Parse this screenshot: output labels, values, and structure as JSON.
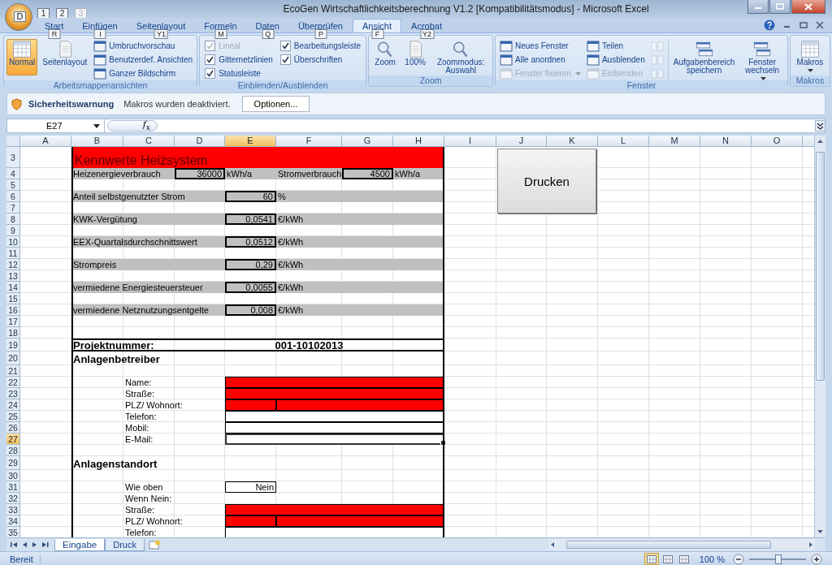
{
  "window": {
    "title": "EcoGen Wirtschaftlichkeitsberechnung V1.2  [Kompatibilitätsmodus] - Microsoft Excel"
  },
  "quick_access": {
    "office_keytip": "D",
    "items": [
      {
        "keytip": "1",
        "disabled": false
      },
      {
        "keytip": "2",
        "disabled": false
      },
      {
        "keytip": "3",
        "disabled": true
      }
    ]
  },
  "tabs": [
    {
      "label": "Start",
      "keytip": "R",
      "selected": false
    },
    {
      "label": "Einfügen",
      "keytip": "I",
      "selected": false
    },
    {
      "label": "Seitenlayout",
      "keytip": "Y1",
      "selected": false
    },
    {
      "label": "Formeln",
      "keytip": "M",
      "selected": false
    },
    {
      "label": "Daten",
      "keytip": "Q",
      "selected": false
    },
    {
      "label": "Überprüfen",
      "keytip": "P",
      "selected": false
    },
    {
      "label": "Ansicht",
      "keytip": "F",
      "selected": true
    },
    {
      "label": "Acrobat",
      "keytip": "Y2",
      "selected": false
    }
  ],
  "ribbon": [
    {
      "label": "Arbeitsmappenansichten",
      "columns": [
        [
          {
            "kind": "large",
            "label": "Normal",
            "selected": true,
            "disabled": false,
            "dropdown": false
          }
        ],
        [
          {
            "kind": "large",
            "label": "Seitenlayout",
            "selected": false,
            "disabled": false,
            "dropdown": false
          }
        ],
        [
          {
            "kind": "small",
            "label": "Umbruchvorschau",
            "disabled": false,
            "dropdown": false
          },
          {
            "kind": "small",
            "label": "Benutzerdef. Ansichten",
            "disabled": false,
            "dropdown": false
          },
          {
            "kind": "small",
            "label": "Ganzer Bildschirm",
            "disabled": false,
            "dropdown": false
          }
        ]
      ]
    },
    {
      "label": "Einblenden/Ausblenden",
      "columns": [
        [
          {
            "kind": "check",
            "label": "Lineal",
            "checked": true,
            "disabled": true
          },
          {
            "kind": "check",
            "label": "Gitternetzlinien",
            "checked": true,
            "disabled": false
          },
          {
            "kind": "check",
            "label": "Statusleiste",
            "checked": true,
            "disabled": false
          }
        ],
        [
          {
            "kind": "check",
            "label": "Bearbeitungsleiste",
            "checked": true,
            "disabled": false
          },
          {
            "kind": "check",
            "label": "Überschriften",
            "checked": true,
            "disabled": false
          }
        ]
      ]
    },
    {
      "label": "Zoom",
      "columns": [
        [
          {
            "kind": "large",
            "label": "Zoom",
            "selected": false,
            "disabled": false,
            "dropdown": false
          }
        ],
        [
          {
            "kind": "large",
            "label": "100%",
            "selected": false,
            "disabled": false,
            "dropdown": false
          }
        ],
        [
          {
            "kind": "large",
            "label": "Zoommodus: Auswahl",
            "selected": false,
            "disabled": false,
            "dropdown": false
          }
        ]
      ]
    },
    {
      "label": "Fenster",
      "columns": [
        [
          {
            "kind": "small",
            "label": "Neues Fenster",
            "disabled": false,
            "dropdown": false
          },
          {
            "kind": "small",
            "label": "Alle anordnen",
            "disabled": false,
            "dropdown": false
          },
          {
            "kind": "small",
            "label": "Fenster fixieren",
            "disabled": true,
            "dropdown": true
          }
        ],
        [
          {
            "kind": "small",
            "label": "Teilen",
            "disabled": false,
            "dropdown": false
          },
          {
            "kind": "small",
            "label": "Ausblenden",
            "disabled": false,
            "dropdown": false
          },
          {
            "kind": "small",
            "label": "Einblenden",
            "disabled": true,
            "dropdown": false
          }
        ],
        [
          {
            "kind": "icon",
            "disabled": true
          },
          {
            "kind": "icon",
            "disabled": true
          },
          {
            "kind": "icon",
            "disabled": true
          }
        ],
        [
          {
            "kind": "large",
            "label": "Aufgabenbereich speichern",
            "selected": false,
            "disabled": false,
            "dropdown": false
          }
        ],
        [
          {
            "kind": "large",
            "label": "Fenster wechseln",
            "selected": false,
            "disabled": false,
            "dropdown": true
          }
        ]
      ]
    },
    {
      "label": "Makros",
      "columns": [
        [
          {
            "kind": "large",
            "label": "Makros",
            "selected": false,
            "disabled": false,
            "dropdown": true
          }
        ]
      ]
    }
  ],
  "security_bar": {
    "title": "Sicherheitswarnung",
    "message": "Makros wurden deaktiviert.",
    "button": "Optionen..."
  },
  "formula_bar": {
    "name_box": "E27",
    "fx": "f$_{x}$"
  },
  "sheet": {
    "columns": [
      {
        "label": "A",
        "selected": false
      },
      {
        "label": "B",
        "selected": false
      },
      {
        "label": "C",
        "selected": false
      },
      {
        "label": "D",
        "selected": false
      },
      {
        "label": "E",
        "selected": true
      },
      {
        "label": "F",
        "selected": false
      },
      {
        "label": "G",
        "selected": false
      },
      {
        "label": "H",
        "selected": false
      },
      {
        "label": "I",
        "selected": false
      },
      {
        "label": "J",
        "selected": false
      },
      {
        "label": "K",
        "selected": false
      },
      {
        "label": "L",
        "selected": false
      },
      {
        "label": "M",
        "selected": false
      },
      {
        "label": "N",
        "selected": false
      },
      {
        "label": "O",
        "selected": false
      }
    ],
    "rows": [
      {
        "number": "3",
        "selected": false,
        "cells": [
          "",
          {
            "kind": "title",
            "text": "Kennwerte Heizsystem"
          },
          "",
          "",
          "",
          "",
          "",
          ""
        ]
      },
      {
        "number": "4",
        "selected": false,
        "shaded": true,
        "cells": [
          "",
          {
            "kind": "label",
            "text": "Heizenergieverbrauch"
          },
          "",
          {
            "kind": "input",
            "text": "36000"
          },
          {
            "kind": "unit",
            "text": "kWh/a"
          },
          {
            "kind": "label",
            "text": "Stromverbrauch"
          },
          {
            "kind": "input",
            "text": "4500"
          },
          {
            "kind": "unit",
            "text": "kWh/a"
          }
        ]
      },
      {
        "number": "5",
        "selected": false,
        "shaded": false,
        "cells": []
      },
      {
        "number": "6",
        "selected": false,
        "shaded": true,
        "cells": [
          "",
          {
            "kind": "label",
            "text": "Anteil selbstgenutzter Strom"
          },
          "",
          "",
          {
            "kind": "input",
            "text": "60"
          },
          {
            "kind": "unit",
            "text": "%"
          }
        ]
      },
      {
        "number": "7",
        "selected": false,
        "shaded": false,
        "cells": []
      },
      {
        "number": "8",
        "selected": false,
        "shaded": true,
        "cells": [
          "",
          {
            "kind": "label",
            "text": "KWK-Vergütung"
          },
          "",
          "",
          {
            "kind": "input",
            "text": "0,0541"
          },
          {
            "kind": "unit",
            "text": "€/kWh"
          }
        ]
      },
      {
        "number": "9",
        "selected": false,
        "shaded": false,
        "cells": []
      },
      {
        "number": "10",
        "selected": false,
        "shaded": true,
        "cells": [
          "",
          {
            "kind": "label",
            "text": "EEX-Quartalsdurchschnittswert"
          },
          "",
          "",
          {
            "kind": "input",
            "text": "0,0512"
          },
          {
            "kind": "unit",
            "text": "€/kWh"
          }
        ]
      },
      {
        "number": "11",
        "selected": false,
        "shaded": false,
        "cells": []
      },
      {
        "number": "12",
        "selected": false,
        "shaded": true,
        "cells": [
          "",
          {
            "kind": "label",
            "text": "Strompreis"
          },
          "",
          "",
          {
            "kind": "input",
            "text": "0,29"
          },
          {
            "kind": "unit",
            "text": "€/kWh"
          }
        ]
      },
      {
        "number": "13",
        "selected": false,
        "shaded": false,
        "cells": []
      },
      {
        "number": "14",
        "selected": false,
        "shaded": true,
        "cells": [
          "",
          {
            "kind": "label",
            "text": "vermiedene Energiesteuersteuer"
          },
          "",
          "",
          {
            "kind": "input",
            "text": "0,0055"
          },
          {
            "kind": "unit",
            "text": "€/kWh"
          }
        ]
      },
      {
        "number": "15",
        "selected": false,
        "shaded": false,
        "cells": []
      },
      {
        "number": "16",
        "selected": false,
        "shaded": true,
        "cells": [
          "",
          {
            "kind": "label",
            "text": "vermiedene Netznutzungsentgelte"
          },
          "",
          "",
          {
            "kind": "input",
            "text": "0,008"
          },
          {
            "kind": "unit",
            "text": "€/kWh"
          }
        ]
      },
      {
        "number": "17",
        "selected": false,
        "shaded": false,
        "cells": []
      },
      {
        "number": "18",
        "selected": false,
        "shaded": false,
        "cells": []
      },
      {
        "number": "19",
        "selected": false,
        "shaded": false,
        "cells": [
          "",
          {
            "kind": "project-label",
            "text": "Projektnummer:"
          },
          "",
          "",
          "",
          {
            "kind": "project-value",
            "text": "001-10102013"
          }
        ]
      },
      {
        "number": "20",
        "selected": false,
        "shaded": false,
        "cells": [
          "",
          {
            "kind": "heading",
            "text": "Anlagenbetreiber"
          },
          "",
          ""
        ]
      },
      {
        "number": "21",
        "selected": false,
        "shaded": false,
        "cells": []
      },
      {
        "number": "22",
        "selected": false,
        "shaded": false,
        "cells": [
          "",
          "",
          {
            "kind": "label",
            "text": "Name:"
          },
          "",
          {
            "kind": "field",
            "color": "#ff0000",
            "selected": false
          },
          "",
          "",
          ""
        ]
      },
      {
        "number": "23",
        "selected": false,
        "shaded": false,
        "cells": [
          "",
          "",
          {
            "kind": "label",
            "text": "Straße:"
          },
          "",
          {
            "kind": "field",
            "color": "#ff0000",
            "selected": false
          },
          "",
          "",
          ""
        ]
      },
      {
        "number": "24",
        "selected": false,
        "shaded": false,
        "cells": [
          "",
          "",
          {
            "kind": "label",
            "text": "PLZ/ Wohnort:"
          },
          "",
          {
            "kind": "field",
            "color": "#ff0000",
            "selected": false
          },
          {
            "kind": "field",
            "color": "#ff0000",
            "selected": false
          },
          "",
          ""
        ]
      },
      {
        "number": "25",
        "selected": false,
        "shaded": false,
        "cells": [
          "",
          "",
          {
            "kind": "label",
            "text": "Telefon:"
          },
          "",
          {
            "kind": "field",
            "color": "#ffffff",
            "selected": false
          },
          "",
          "",
          ""
        ]
      },
      {
        "number": "26",
        "selected": false,
        "shaded": false,
        "cells": [
          "",
          "",
          {
            "kind": "label",
            "text": "Mobil:"
          },
          "",
          {
            "kind": "field",
            "color": "#ffffff",
            "selected": false
          },
          "",
          "",
          ""
        ]
      },
      {
        "number": "27",
        "selected": true,
        "shaded": false,
        "cells": [
          "",
          "",
          {
            "kind": "label",
            "text": "E-Mail:"
          },
          "",
          {
            "kind": "field",
            "color": "#ffffff",
            "selected": true
          },
          "",
          "",
          ""
        ]
      },
      {
        "number": "28",
        "selected": false,
        "shaded": false,
        "cells": []
      },
      {
        "number": "29",
        "selected": false,
        "shaded": false,
        "cells": [
          "",
          {
            "kind": "heading",
            "text": "Anlagenstandort"
          },
          "",
          ""
        ]
      },
      {
        "number": "30",
        "selected": false,
        "shaded": false,
        "cells": []
      },
      {
        "number": "31",
        "selected": false,
        "shaded": false,
        "cells": [
          "",
          "",
          {
            "kind": "label",
            "text": "Wie oben"
          },
          "",
          {
            "kind": "field",
            "color": "#ffffff",
            "selected": false,
            "text": "Nein"
          }
        ]
      },
      {
        "number": "32",
        "selected": false,
        "shaded": false,
        "cells": [
          "",
          "",
          {
            "kind": "label",
            "text": "Wenn Nein:"
          },
          ""
        ]
      },
      {
        "number": "33",
        "selected": false,
        "shaded": false,
        "cells": [
          "",
          "",
          {
            "kind": "label",
            "text": "Straße:"
          },
          "",
          {
            "kind": "field",
            "color": "#ff0000",
            "selected": false
          },
          "",
          "",
          ""
        ]
      },
      {
        "number": "34",
        "selected": false,
        "shaded": false,
        "cells": [
          "",
          "",
          {
            "kind": "label",
            "text": "PLZ/ Wohnort:"
          },
          "",
          {
            "kind": "field",
            "color": "#ff0000",
            "selected": false
          },
          {
            "kind": "field",
            "color": "#ff0000",
            "selected": false
          },
          "",
          ""
        ]
      },
      {
        "number": "35",
        "selected": false,
        "shaded": false,
        "cells": [
          "",
          "",
          {
            "kind": "label",
            "text": "Telefon:"
          },
          "",
          {
            "kind": "field",
            "color": "#ffffff",
            "selected": false
          },
          "",
          "",
          ""
        ]
      }
    ],
    "button": {
      "label": "Drucken"
    }
  },
  "sheet_tabs": [
    {
      "label": "Eingabe",
      "selected": true
    },
    {
      "label": "Druck",
      "selected": false
    }
  ],
  "status_bar": {
    "text": "Bereit",
    "views": [
      {
        "selected": true
      },
      {
        "selected": false
      },
      {
        "selected": false
      }
    ],
    "zoom": "100 %",
    "zoom_slider": {
      "level": 0.5
    }
  }
}
